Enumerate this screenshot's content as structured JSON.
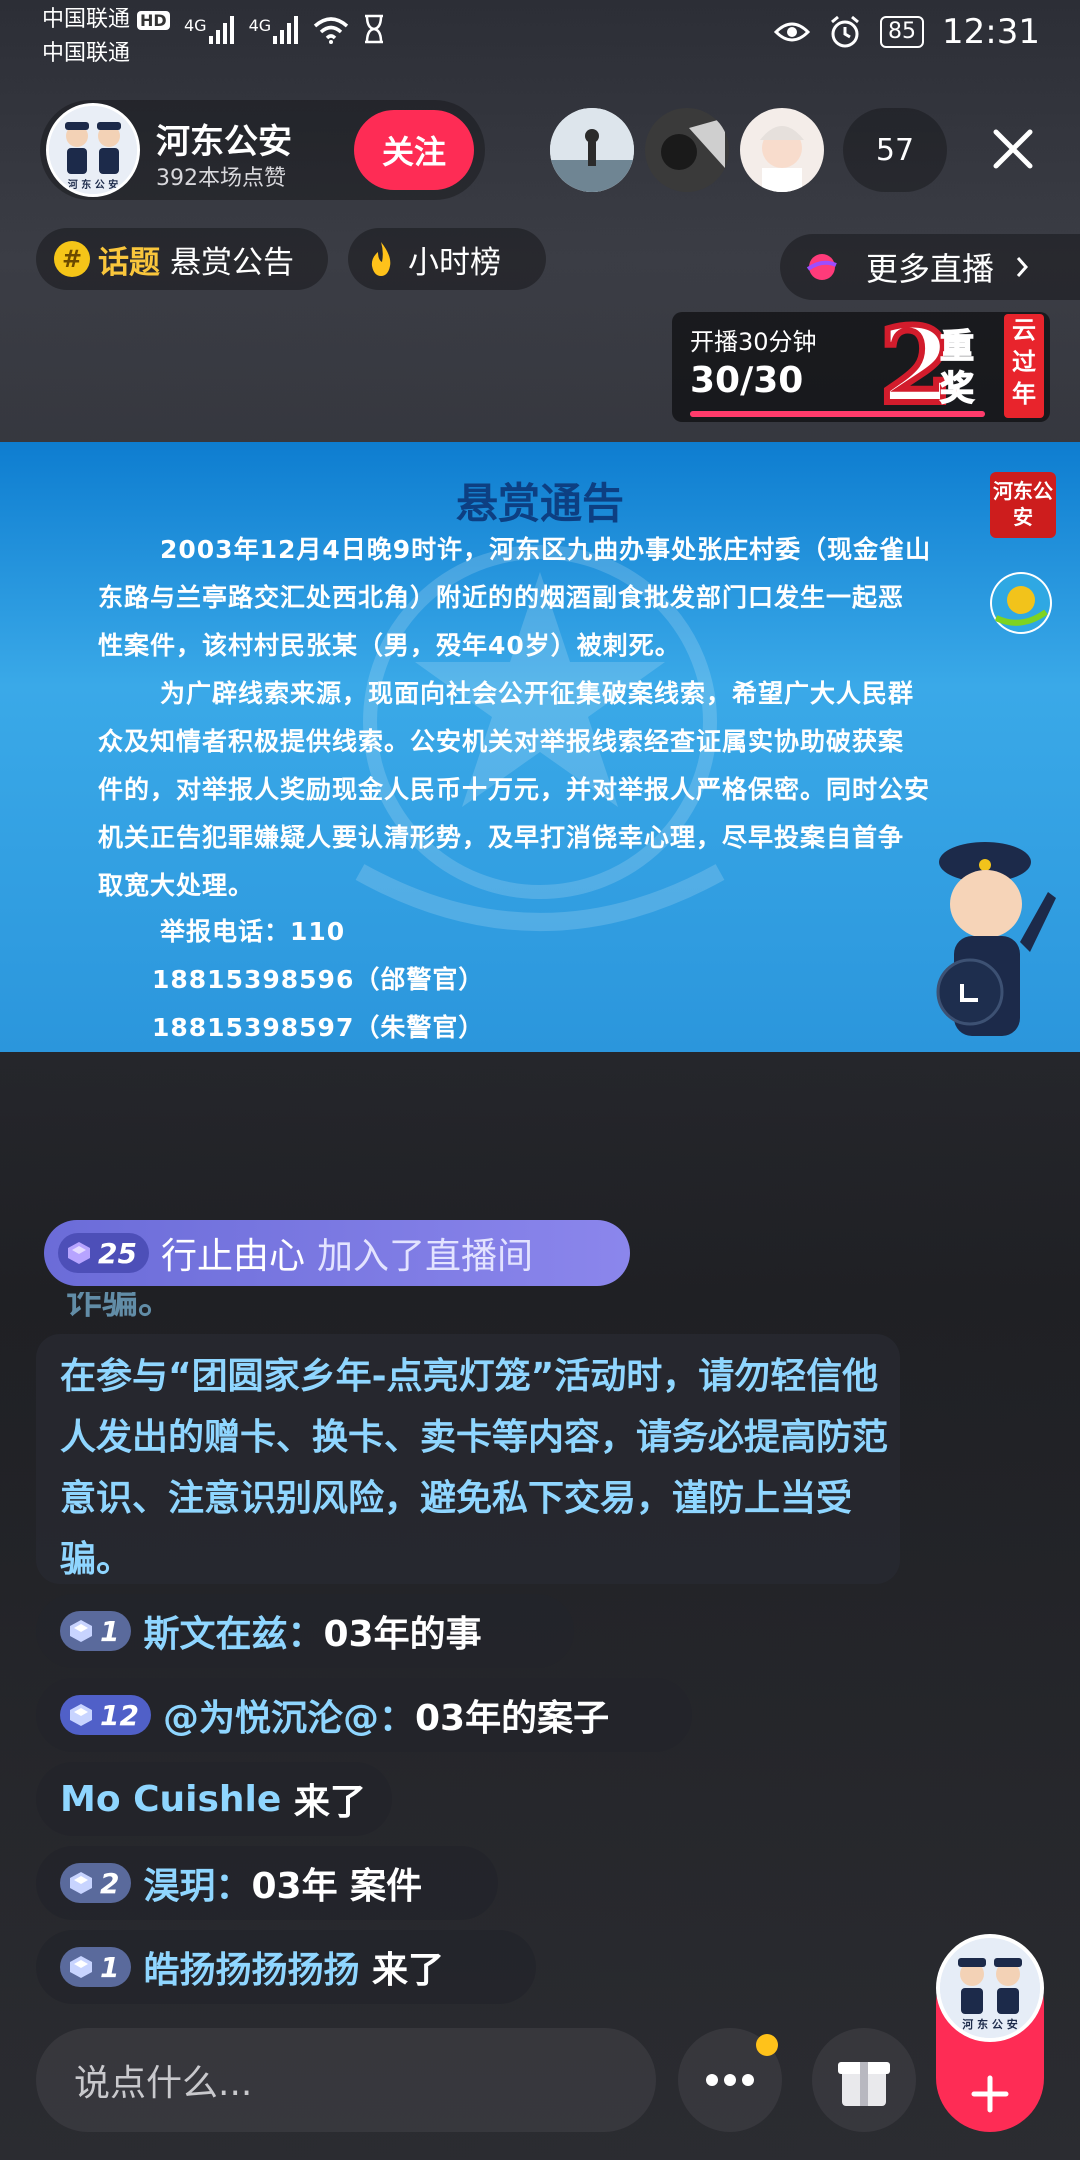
{
  "status_bar": {
    "carrier_1": "中国联通",
    "carrier_1_tag": "HD",
    "carrier_2": "中国联通",
    "signal_1": "4G",
    "signal_2": "4G",
    "battery": "85",
    "time": "12:31"
  },
  "host": {
    "name": "河东公安",
    "likes": "392本场点赞",
    "follow_label": "关注",
    "avatar_caption": "河 东 公 安"
  },
  "viewers": {
    "count": "57"
  },
  "topic": {
    "label": "话题",
    "text": "悬赏公告"
  },
  "hour_rank": {
    "label": "小时榜"
  },
  "more_live": {
    "label": "更多直播"
  },
  "promo_banner": {
    "title": "开播30分钟",
    "progress_text": "30/30",
    "progress_fraction": 1.0,
    "award_number": "2",
    "award_chars": "重奖",
    "side_text": "云过年"
  },
  "video": {
    "title": "悬赏通告",
    "p1_l1": "2003年12月4日晚9时许，河东区九曲办事处张庄村委（现金雀山",
    "p1_l2": "东路与兰亭路交汇处西北角）附近的的烟酒副食批发部门口发生一起恶",
    "p1_l3": "性案件，该村村民张某（男，殁年40岁）被刺死。",
    "p2_l1": "为广辟线索来源，现面向社会公开征集破案线索，希望广大人民群",
    "p2_l2": "众及知情者积极提供线索。公安机关对举报线索经查证属实协助破获案",
    "p2_l3": "件的，对举报人奖励现金人民币十万元，并对举报人严格保密。同时公安",
    "p2_l4": "机关正告犯罪嫌疑人要认清形势，及早打消侥幸心理，尽早投案自首争",
    "p2_l5": "取宽大处理。",
    "hotline": "举报电话：110",
    "phone_1": "18815398596（邰警官）",
    "phone_2": "18815398597（朱警官）",
    "seal_text": "河东公安"
  },
  "join_notice": {
    "level": "25",
    "user": "行止由心",
    "action": "加入了直播间"
  },
  "chat_notice": {
    "partial": "诈骗。",
    "text": "在参与“团圆家乡年-点亮灯笼”活动时，请勿轻信他人发出的赠卡、换卡、卖卡等内容，请务必提高防范意识、注意识别风险，避免私下交易，谨防上当受骗。"
  },
  "messages": [
    {
      "level": "1",
      "user": "斯文在兹：",
      "text": "03年的事"
    },
    {
      "level": "12",
      "user": "@为悦沉沦@：",
      "text": "03年的案子"
    },
    {
      "level": "",
      "user": "Mo Cuishle",
      "text": " 来了"
    },
    {
      "level": "2",
      "user": "淏玥：",
      "text": "03年 案件"
    },
    {
      "level": "1",
      "user": "皓扬扬扬扬扬",
      "text": " 来了"
    }
  ],
  "bottom_bar": {
    "input_placeholder": "说点什么...",
    "plus_avatar_caption": "河 东 公 安"
  },
  "colors": {
    "accent": "#fe2c55",
    "username": "#8fd6ff",
    "topic": "#f9c63c",
    "join_bar": "#7b7ae4"
  }
}
